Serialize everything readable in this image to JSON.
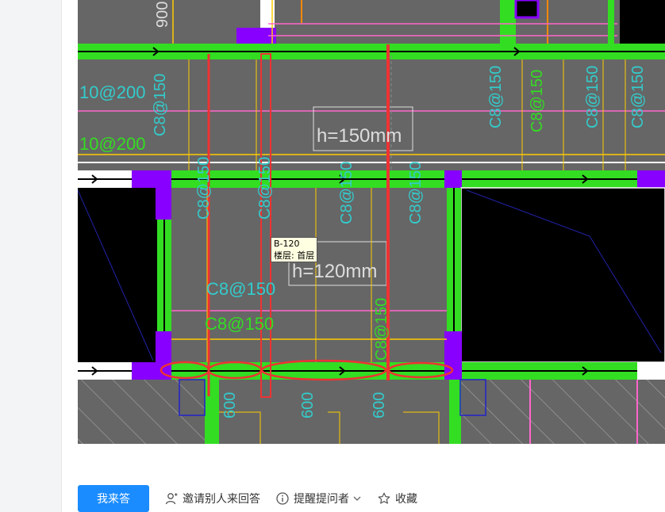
{
  "drawing": {
    "labels": {
      "dim_900": "900",
      "rebar_10_200_a": "10@200",
      "rebar_10_200_b": "10@200",
      "c8_150_left_top": "C8@150",
      "h150": "h=150mm",
      "c8_150_r1": "C8@150",
      "c8_150_r2": "C8@150",
      "c8_150_r3": "C8@150",
      "c8_150_r4": "C8@150",
      "c8_150_mid1": "C8@150",
      "c8_150_mid2": "C8@150",
      "c8_150_mid3": "C8@150",
      "c8_150_mid4": "C8@150",
      "h120": "h=120mm",
      "c8_150_h1": "C8@150",
      "c8_150_h2": "C8@150",
      "c8_150_low": "C8@150",
      "dim_600_a": "600",
      "dim_600_b": "600",
      "dim_600_c": "600"
    },
    "tooltip": {
      "line1": "B-120",
      "line2": "楼层: 首层"
    }
  },
  "actions": {
    "answer_label": "我来答",
    "invite_label": "邀请别人来回答",
    "remind_label": "提醒提问者",
    "favorite_label": "收藏"
  },
  "colors": {
    "primary": "#1a8cff",
    "cad_background": "#666666",
    "green": "#33dd22",
    "purple": "#8800ff",
    "red": "#ee3333",
    "cyan": "#33cccc"
  }
}
